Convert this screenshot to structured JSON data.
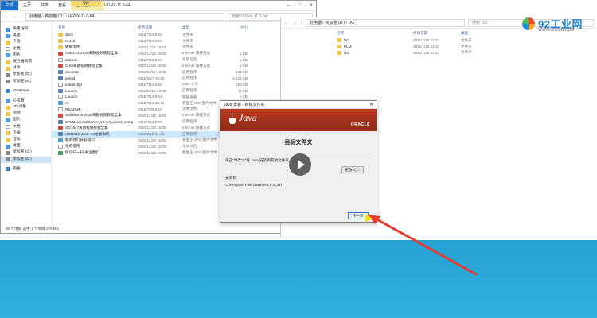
{
  "left_window": {
    "context_tab_header": "管理",
    "title": "UGNX-11.0-64",
    "tabs": [
      "文件",
      "主页",
      "共享",
      "查看",
      "应用程序工具"
    ],
    "address": "此电脑 › 新加卷 (D:) › UGNX-11.0-64",
    "search_placeholder": "搜索\"UGNX-11.0-64\"",
    "columns": {
      "name": "名称",
      "date": "修改日期",
      "type": "类型",
      "size": "大小"
    },
    "nav": [
      {
        "label": "快速访问",
        "icon": "star"
      },
      {
        "label": "桌面",
        "icon": "pc"
      },
      {
        "label": "下载",
        "icon": "folder"
      },
      {
        "label": "文档",
        "icon": "doc"
      },
      {
        "label": "图片",
        "icon": "pic"
      },
      {
        "label": "服务器资源",
        "icon": "folder"
      },
      {
        "label": "共享",
        "icon": "folder"
      },
      {
        "label": "新加卷 (D:)",
        "icon": "disk"
      },
      {
        "label": "新加卷 (E:)",
        "icon": "disk"
      },
      {
        "label": "OneDrive",
        "icon": "cloud"
      },
      {
        "label": "此电脑",
        "icon": "pc"
      },
      {
        "label": "3D 对象",
        "icon": "folder"
      },
      {
        "label": "视频",
        "icon": "folder"
      },
      {
        "label": "图片",
        "icon": "pic"
      },
      {
        "label": "文档",
        "icon": "doc"
      },
      {
        "label": "下载",
        "icon": "folder"
      },
      {
        "label": "音乐",
        "icon": "folder"
      },
      {
        "label": "桌面",
        "icon": "pc"
      },
      {
        "label": "新加卷 (C:)",
        "icon": "disk"
      },
      {
        "label": "新加卷 (D:)",
        "icon": "disk"
      },
      {
        "label": "网络",
        "icon": "net"
      }
    ],
    "files": [
      {
        "name": "docs",
        "date": "2016/7/23 8:00",
        "type": "文件夹",
        "size": "",
        "icon": "folder"
      },
      {
        "name": "nx110",
        "date": "2016/7/23 2:59",
        "type": "文件夹",
        "size": "",
        "icon": "folder"
      },
      {
        "name": "破解文件",
        "date": "2020/12/22 16:01",
        "type": "文件夹",
        "size": "",
        "icon": "folder"
      },
      {
        "name": "AutoCAD2020离散视频教程全集",
        "date": "2020/12/22 16:05",
        "type": "Internet 快捷方式",
        "size": "1 KB",
        "icon": "red"
      },
      {
        "name": "autorun",
        "date": "2016/7/15 8:02",
        "type": "安装信息",
        "size": "1 KB",
        "icon": "doc"
      },
      {
        "name": "Creo离散视频教程全集",
        "date": "2020/12/22 16:05",
        "type": "Internet 快捷方式",
        "size": "1 KB",
        "icon": "red"
      },
      {
        "name": "demo32",
        "date": "2001/11/14 13:46",
        "type": "应用程序",
        "size": "440 KB",
        "icon": "app"
      },
      {
        "name": "getsid",
        "date": "2016/6/27 15:30",
        "type": "应用程序",
        "size": "2,213 KB",
        "icon": "app"
      },
      {
        "name": "Install.dbd",
        "date": "2016/7/13 8:00",
        "type": "DBD 文件",
        "size": "159 KB",
        "icon": "doc"
      },
      {
        "name": "Launch",
        "date": "2001/11/14 13:46",
        "type": "应用程序",
        "size": "41 KB",
        "icon": "app"
      },
      {
        "name": "Launch",
        "date": "2016/7/13 8:01",
        "type": "配置设置",
        "size": "1 KB",
        "icon": "doc"
      },
      {
        "name": "nx",
        "date": "2016/7/13 10:46",
        "type": "看图王 ICO 图片文件",
        "size": "25 KB",
        "icon": "pic"
      },
      {
        "name": "README",
        "date": "2016/7/26 0:10",
        "type": "文本文档",
        "size": "1 KB",
        "icon": "doc"
      },
      {
        "name": "Solidworks-2016离散视频教程全集",
        "date": "2020/12/22 16:05",
        "type": "Internet 快捷方式",
        "size": "1 KB",
        "icon": "red"
      },
      {
        "name": "SPLMLicenseServer_v8.2.0_win64_setup",
        "date": "2016/7/13 8:00",
        "type": "应用程序",
        "size": "40,930 KB",
        "icon": "app"
      },
      {
        "name": "UG1847离散视频教程全集",
        "date": "2020/12/22 16:05",
        "type": "Internet 快捷方式",
        "size": "1 KB",
        "icon": "red"
      },
      {
        "name": "UGNX11-JAVA-64位虚拟机",
        "date": "2016/9/18 21:10",
        "type": "应用程序",
        "size": "70,570 KB",
        "icon": "app"
      },
      {
        "name": "联系我们获取福利",
        "date": "2020/12/22 16:05",
        "type": "看图王 JPG 图片文件",
        "size": "30 KB",
        "icon": "pic"
      },
      {
        "name": "免费使用",
        "date": "2020/12/22 16:05",
        "type": "文本文档",
        "size": "1 KB",
        "icon": "doc"
      },
      {
        "name": "微信扫一扫-关注我们",
        "date": "2020/12/22 16:05",
        "type": "看图王 JPG 图片文件",
        "size": "37 KB",
        "icon": "green"
      }
    ],
    "selected_index": 16,
    "status": "20 个项目    选中 1 个项目  170 MB"
  },
  "right_window": {
    "address": "此电脑 › 新加卷 (D:) › UG",
    "search_placeholder": "搜索\"UG\"",
    "columns": {
      "name": "名称",
      "date": "修改日期",
      "type": "类型"
    },
    "files": [
      {
        "name": "UC",
        "date": "2021/1/15 13:41",
        "type": "文件夹"
      },
      {
        "name": "PLM",
        "date": "2021/1/15 13:41",
        "type": "文件夹"
      },
      {
        "name": "UG",
        "date": "2021/1/15 13:41",
        "type": "文件夹"
      }
    ]
  },
  "logo": {
    "text": "92工业网",
    "url": "WWW.92GYW.COM"
  },
  "dialog": {
    "title": "Java 安装 - 目标文件夹",
    "brand": "Java",
    "oracle": "ORACLE",
    "heading": "目标文件夹",
    "instruction": "单击\"更改\"以将 Java 安装到其他文件夹。",
    "install_to_label": "安装到:",
    "install_path": "C:\\Program Files\\Java\\jre1.8.0_31\\",
    "change_button": "更改(C)...",
    "next_button": "下一步"
  },
  "colors": {
    "accent": "#1a6fc9",
    "selection": "#cce8ff",
    "java_banner": "#b83a22",
    "arrow": "#e53a2f",
    "desktop": "#2fb0dd"
  }
}
